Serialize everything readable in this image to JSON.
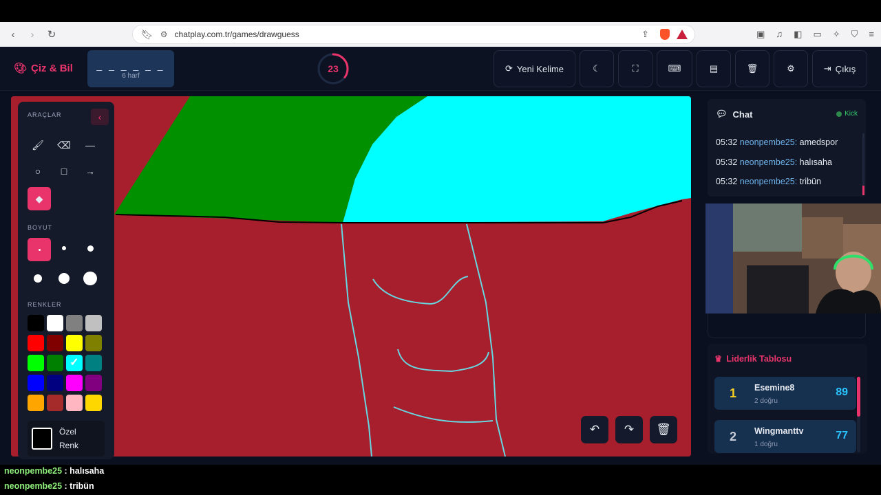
{
  "browser": {
    "url": "chatplay.com.tr/games/drawguess",
    "nav_icons": [
      "back-icon",
      "forward-icon",
      "reload-icon"
    ]
  },
  "header": {
    "logo_text": "Çiz & Bil",
    "word_dashes": "_ _ _ _ _ _",
    "word_hint": "6 harf",
    "timer": "23",
    "timer_fraction": 0.35,
    "new_word_label": "Yeni Kelime",
    "exit_label": "Çıkış"
  },
  "tools": {
    "tools_title": "ARAÇLAR",
    "size_title": "BOYUT",
    "colors_title": "RENKLER",
    "custom_label_1": "Özel",
    "custom_label_2": "Renk",
    "colors": [
      "#000000",
      "#ffffff",
      "#808080",
      "#c0c0c0",
      "#ff0000",
      "#800000",
      "#ffff00",
      "#808000",
      "#00ff00",
      "#008000",
      "#00ffff",
      "#008080",
      "#0000ff",
      "#000080",
      "#ff00ff",
      "#800080",
      "#ffa500",
      "#a52a2a",
      "#ffb6c1",
      "#ffd700"
    ],
    "selected_color": "#00ffff",
    "brand_color": "#e8346b"
  },
  "chat": {
    "title": "Chat",
    "status": "Kick",
    "messages": [
      {
        "time": "05:32",
        "user": "neonpembe25:",
        "text": "amedspor"
      },
      {
        "time": "05:32",
        "user": "neonpembe25:",
        "text": "halısaha"
      },
      {
        "time": "05:32",
        "user": "neonpembe25:",
        "text": "tribün"
      }
    ]
  },
  "leaderboard": {
    "title": "Liderlik Tablosu",
    "rows": [
      {
        "rank": "1",
        "name": "Esemine8",
        "sub": "2 doğru",
        "points": "89"
      },
      {
        "rank": "2",
        "name": "Wingmanttv",
        "sub": "1 doğru",
        "points": "77"
      }
    ]
  },
  "stream_chat": [
    {
      "user": "neonpembe25",
      "text": "halısaha"
    },
    {
      "user": "neonpembe25",
      "text": "tribün"
    }
  ]
}
